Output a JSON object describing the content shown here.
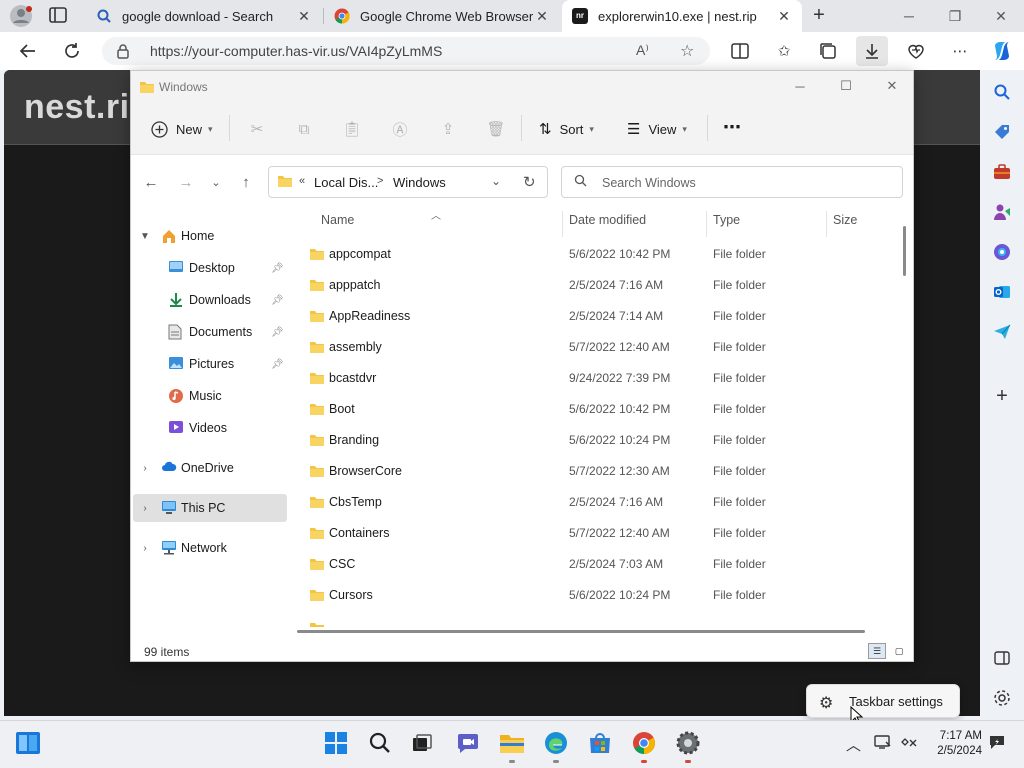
{
  "browser": {
    "tabs": [
      {
        "title": "google download - Search",
        "icon": "search-icon"
      },
      {
        "title": "Google Chrome Web Browser",
        "icon": "chrome-icon"
      },
      {
        "title": "explorerwin10.exe | nest.rip",
        "icon": "nestrip-icon",
        "icon_text": "nr",
        "active": true
      }
    ],
    "url": "https://your-computer.has-vir.us/VAI4pZyLmMS",
    "page_title": "nest.ri"
  },
  "explorer": {
    "title": "Windows",
    "toolbar": {
      "new_label": "New",
      "sort_label": "Sort",
      "view_label": "View",
      "more_label": "⋯"
    },
    "breadcrumb": {
      "overflow": "«",
      "part1": "Local Dis...",
      "arrow": ">",
      "part2": "Windows"
    },
    "search_placeholder": "Search Windows",
    "nav": {
      "home": "Home",
      "desktop": "Desktop",
      "downloads": "Downloads",
      "documents": "Documents",
      "pictures": "Pictures",
      "music": "Music",
      "videos": "Videos",
      "onedrive": "OneDrive",
      "thispc": "This PC",
      "network": "Network"
    },
    "columns": {
      "name": "Name",
      "date": "Date modified",
      "type": "Type",
      "size": "Size"
    },
    "rows": [
      {
        "name": "appcompat",
        "date": "5/6/2022 10:42 PM",
        "type": "File folder"
      },
      {
        "name": "apppatch",
        "date": "2/5/2024 7:16 AM",
        "type": "File folder"
      },
      {
        "name": "AppReadiness",
        "date": "2/5/2024 7:14 AM",
        "type": "File folder"
      },
      {
        "name": "assembly",
        "date": "5/7/2022 12:40 AM",
        "type": "File folder"
      },
      {
        "name": "bcastdvr",
        "date": "9/24/2022 7:39 PM",
        "type": "File folder"
      },
      {
        "name": "Boot",
        "date": "5/6/2022 10:42 PM",
        "type": "File folder"
      },
      {
        "name": "Branding",
        "date": "5/6/2022 10:24 PM",
        "type": "File folder"
      },
      {
        "name": "BrowserCore",
        "date": "5/7/2022 12:30 AM",
        "type": "File folder"
      },
      {
        "name": "CbsTemp",
        "date": "2/5/2024 7:16 AM",
        "type": "File folder"
      },
      {
        "name": "Containers",
        "date": "5/7/2022 12:40 AM",
        "type": "File folder"
      },
      {
        "name": "CSC",
        "date": "2/5/2024 7:03 AM",
        "type": "File folder"
      },
      {
        "name": "Cursors",
        "date": "5/6/2022 10:24 PM",
        "type": "File folder"
      }
    ],
    "status": "99 items"
  },
  "popup": {
    "label": "Taskbar settings"
  },
  "clock": {
    "time": "7:17 AM",
    "date": "2/5/2024"
  },
  "colors": {
    "folder": "#f4c542",
    "accent": "#0067c0",
    "chrome_red": "#db4437"
  }
}
